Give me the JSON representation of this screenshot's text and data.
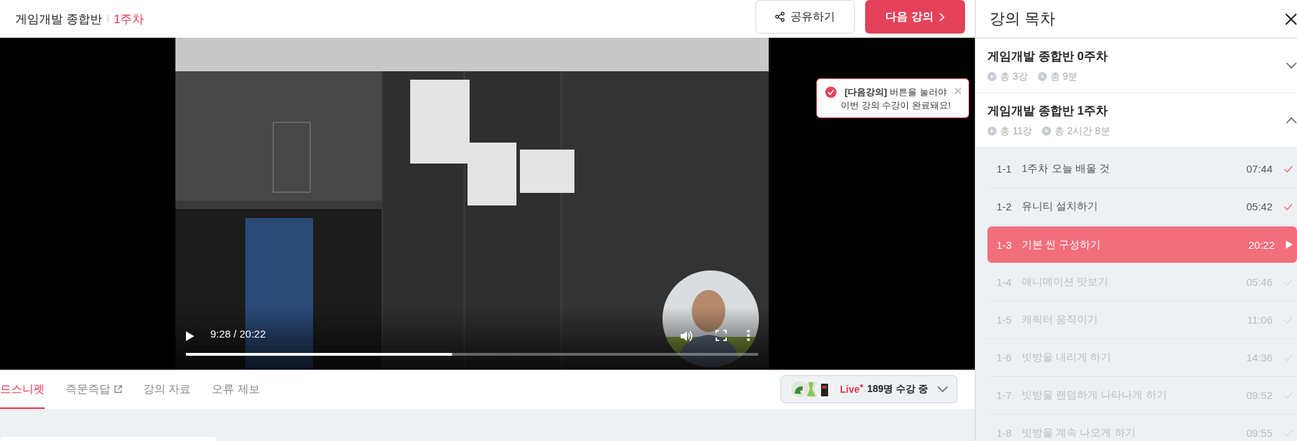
{
  "header": {
    "course": "게임개발 종합반",
    "week": "1주차",
    "buttons": [
      {
        "label": "공유하기",
        "kind": "share"
      },
      {
        "label": "다음 강의",
        "kind": "next"
      }
    ]
  },
  "tooltip": {
    "text": "**[다음강의]** 버튼을 눌러야\n이번 강의 수강이 완료돼요!"
  },
  "player": {
    "time": "9:28 / 20:22",
    "level": 0.465
  },
  "tabs": [
    {
      "label": "드스니펫",
      "selected": true,
      "external": false
    },
    {
      "label": "즉문즉답",
      "selected": false,
      "external": true
    },
    {
      "label": "강의 자료",
      "selected": false,
      "external": false
    },
    {
      "label": "오류 제보",
      "selected": false,
      "external": false
    }
  ],
  "live": {
    "badge": "Live",
    "viewers": "189명 수강 중"
  },
  "sidebar": {
    "title": "강의 목차",
    "sections": [
      {
        "title": "게임개발 종합반 0주차",
        "count": "총 3강",
        "duration": "총 9분",
        "expanded": false
      },
      {
        "title": "게임개발 종합반 1주차",
        "count": "총 11강",
        "duration": "총 2시간 8분",
        "expanded": true,
        "items": [
          {
            "number": "1-1",
            "title": "1주차 오늘 배울 것",
            "time": "07:44",
            "completed": true,
            "selected": false
          },
          {
            "number": "1-2",
            "title": "유니티 설치하기",
            "time": "05:42",
            "completed": true,
            "selected": false
          },
          {
            "number": "1-3",
            "title": "기본 씬 구성하기",
            "time": "20:22",
            "completed": false,
            "selected": true
          },
          {
            "number": "1-4",
            "title": "애니메이션 맛보기",
            "time": "05:46",
            "completed": false,
            "selected": false
          },
          {
            "number": "1-5",
            "title": "캐릭터 움직이기",
            "time": "11:06",
            "completed": false,
            "selected": false
          },
          {
            "number": "1-6",
            "title": "빗방울 내리게 하기",
            "time": "14:36",
            "completed": false,
            "selected": false
          },
          {
            "number": "1-7",
            "title": "빗방울 랜덤하게 나타나게 하기",
            "time": "09:52",
            "completed": false,
            "selected": false
          },
          {
            "number": "1-8",
            "title": "빗방울 계속 나오게 하기",
            "time": "09:55",
            "completed": false,
            "selected": false
          }
        ]
      }
    ]
  }
}
